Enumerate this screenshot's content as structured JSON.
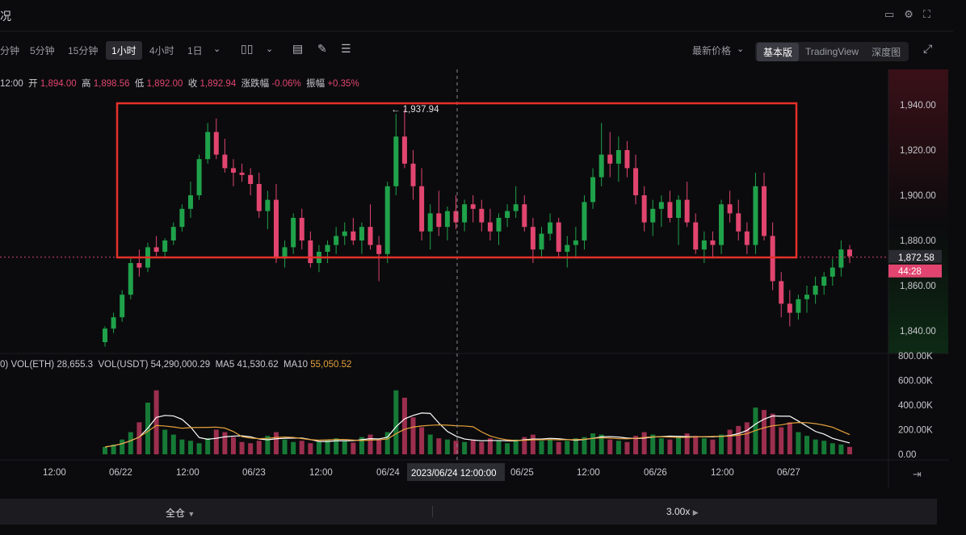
{
  "header": {
    "title": "况"
  },
  "toolbar": {
    "intervals": [
      "分钟",
      "5分钟",
      "15分钟",
      "1小时",
      "4小时",
      "1日"
    ],
    "active_interval": "1小时",
    "price_mode": "最新价格",
    "views": [
      "基本版",
      "TradingView",
      "深度图"
    ],
    "active_view": "基本版"
  },
  "ohlc": {
    "time": "12:00",
    "open_label": "开",
    "open": "1,894.00",
    "high_label": "高",
    "high": "1,898.56",
    "low_label": "低",
    "low": "1,892.00",
    "close_label": "收",
    "close": "1,892.94",
    "change_label": "涨跌幅",
    "change": "-0.06%",
    "amp_label": "振幅",
    "amp": "+0.35%"
  },
  "volume_legend": {
    "prefix": "0)",
    "vol_eth_label": "VOL(ETH)",
    "vol_eth": "28,655.3",
    "vol_usdt_label": "VOL(USDT)",
    "vol_usdt": "54,290,000.29",
    "ma5_label": "MA5",
    "ma5": "41,530.62",
    "ma10_label": "MA10",
    "ma10": "55,050.52"
  },
  "price_axis": {
    "ticks": [
      "1,940.00",
      "1,920.00",
      "1,900.00",
      "1,880.00",
      "1,860.00",
      "1,840.00"
    ],
    "current_price": "1,872.58",
    "countdown": "44:28",
    "max_marker": "← 1,937.94"
  },
  "volume_axis": {
    "ticks": [
      "800.00K",
      "600.00K",
      "400.00K",
      "200.00K",
      "0.00"
    ]
  },
  "time_axis": {
    "labels": [
      "12:00",
      "06/22",
      "12:00",
      "06/23",
      "12:00",
      "06/24",
      "06/25",
      "12:00",
      "06/26",
      "12:00",
      "06/27"
    ],
    "crosshair_label": "2023/06/24 12:00:00"
  },
  "bottom_bar": {
    "margin_mode": "全仓",
    "leverage": "3.00x"
  },
  "colors": {
    "up": "#1fa24a",
    "down": "#e1456f",
    "highlight_box": "#e5302a",
    "background": "#0b0b0d"
  },
  "chart_data": {
    "type": "candlestick",
    "pair_quote": "USDT",
    "ylim": [
      1832,
      1950
    ],
    "max_price": 1937.94,
    "current_price": 1872.58,
    "candles_ohlc": [
      [
        1835,
        1842,
        1833,
        1841
      ],
      [
        1841,
        1848,
        1839,
        1846
      ],
      [
        1846,
        1858,
        1844,
        1856
      ],
      [
        1856,
        1872,
        1854,
        1870
      ],
      [
        1870,
        1876,
        1864,
        1868
      ],
      [
        1868,
        1879,
        1866,
        1877
      ],
      [
        1877,
        1882,
        1873,
        1875
      ],
      [
        1875,
        1881,
        1872,
        1880
      ],
      [
        1880,
        1888,
        1878,
        1886
      ],
      [
        1886,
        1896,
        1884,
        1894
      ],
      [
        1894,
        1906,
        1890,
        1900
      ],
      [
        1900,
        1918,
        1898,
        1916
      ],
      [
        1916,
        1932,
        1914,
        1928
      ],
      [
        1928,
        1934,
        1916,
        1918
      ],
      [
        1918,
        1925,
        1910,
        1912
      ],
      [
        1912,
        1916,
        1904,
        1910
      ],
      [
        1910,
        1914,
        1906,
        1909
      ],
      [
        1909,
        1912,
        1900,
        1905
      ],
      [
        1905,
        1910,
        1890,
        1893
      ],
      [
        1893,
        1902,
        1885,
        1898
      ],
      [
        1898,
        1905,
        1870,
        1872
      ],
      [
        1872,
        1880,
        1868,
        1877
      ],
      [
        1877,
        1892,
        1874,
        1890
      ],
      [
        1890,
        1894,
        1876,
        1880
      ],
      [
        1880,
        1884,
        1868,
        1870
      ],
      [
        1870,
        1878,
        1866,
        1875
      ],
      [
        1875,
        1880,
        1870,
        1878
      ],
      [
        1878,
        1886,
        1874,
        1882
      ],
      [
        1882,
        1888,
        1878,
        1884
      ],
      [
        1884,
        1890,
        1878,
        1880
      ],
      [
        1880,
        1888,
        1874,
        1886
      ],
      [
        1886,
        1896,
        1876,
        1878
      ],
      [
        1878,
        1882,
        1862,
        1874
      ],
      [
        1874,
        1906,
        1870,
        1904
      ],
      [
        1904,
        1936,
        1900,
        1926
      ],
      [
        1926,
        1938,
        1912,
        1914
      ],
      [
        1914,
        1920,
        1898,
        1904
      ],
      [
        1904,
        1912,
        1880,
        1884
      ],
      [
        1884,
        1896,
        1876,
        1892
      ],
      [
        1892,
        1902,
        1882,
        1886
      ],
      [
        1886,
        1895,
        1880,
        1893
      ],
      [
        1893,
        1900,
        1885,
        1888
      ],
      [
        1888,
        1898,
        1884,
        1896
      ],
      [
        1896,
        1900,
        1888,
        1894
      ],
      [
        1894,
        1898,
        1884,
        1888
      ],
      [
        1888,
        1894,
        1880,
        1884
      ],
      [
        1884,
        1892,
        1878,
        1890
      ],
      [
        1890,
        1896,
        1886,
        1893
      ],
      [
        1893,
        1904,
        1890,
        1896
      ],
      [
        1896,
        1900,
        1884,
        1886
      ],
      [
        1886,
        1890,
        1870,
        1876
      ],
      [
        1876,
        1886,
        1872,
        1883
      ],
      [
        1883,
        1892,
        1880,
        1888
      ],
      [
        1888,
        1890,
        1872,
        1875
      ],
      [
        1875,
        1882,
        1868,
        1878
      ],
      [
        1878,
        1886,
        1872,
        1880
      ],
      [
        1880,
        1900,
        1876,
        1897
      ],
      [
        1897,
        1912,
        1894,
        1908
      ],
      [
        1908,
        1932,
        1904,
        1918
      ],
      [
        1918,
        1928,
        1908,
        1914
      ],
      [
        1914,
        1926,
        1906,
        1920
      ],
      [
        1920,
        1924,
        1908,
        1912
      ],
      [
        1912,
        1918,
        1896,
        1900
      ],
      [
        1900,
        1904,
        1884,
        1888
      ],
      [
        1888,
        1898,
        1882,
        1894
      ],
      [
        1894,
        1900,
        1886,
        1897
      ],
      [
        1897,
        1902,
        1888,
        1890
      ],
      [
        1890,
        1900,
        1878,
        1898
      ],
      [
        1898,
        1906,
        1886,
        1888
      ],
      [
        1888,
        1892,
        1874,
        1876
      ],
      [
        1876,
        1884,
        1870,
        1880
      ],
      [
        1880,
        1884,
        1872,
        1878
      ],
      [
        1878,
        1898,
        1874,
        1896
      ],
      [
        1896,
        1902,
        1888,
        1892
      ],
      [
        1892,
        1898,
        1880,
        1884
      ],
      [
        1884,
        1888,
        1874,
        1878
      ],
      [
        1878,
        1910,
        1874,
        1904
      ],
      [
        1904,
        1910,
        1880,
        1882
      ],
      [
        1882,
        1888,
        1858,
        1862
      ],
      [
        1862,
        1866,
        1846,
        1852
      ],
      [
        1852,
        1858,
        1842,
        1848
      ],
      [
        1848,
        1856,
        1845,
        1854
      ],
      [
        1854,
        1860,
        1848,
        1856
      ],
      [
        1856,
        1864,
        1852,
        1860
      ],
      [
        1860,
        1866,
        1856,
        1864
      ],
      [
        1864,
        1872,
        1860,
        1868
      ],
      [
        1868,
        1880,
        1864,
        1876
      ],
      [
        1876,
        1878,
        1870,
        1873
      ]
    ],
    "volume_ylim": [
      0,
      800
    ],
    "volume_k": [
      60,
      80,
      120,
      180,
      260,
      420,
      520,
      200,
      160,
      120,
      110,
      90,
      130,
      200,
      180,
      140,
      100,
      90,
      110,
      150,
      180,
      120,
      100,
      110,
      90,
      100,
      120,
      130,
      110,
      95,
      140,
      160,
      120,
      180,
      520,
      460,
      300,
      220,
      160,
      130,
      120,
      110,
      100,
      120,
      100,
      130,
      110,
      90,
      120,
      140,
      160,
      110,
      120,
      100,
      110,
      130,
      140,
      170,
      160,
      120,
      110,
      100,
      150,
      180,
      160,
      130,
      120,
      140,
      170,
      150,
      130,
      120,
      160,
      200,
      230,
      260,
      380,
      360,
      330,
      220,
      260,
      180,
      150,
      120,
      110,
      90,
      80,
      60
    ],
    "ma_legend": [
      "MA5",
      "MA10"
    ]
  }
}
